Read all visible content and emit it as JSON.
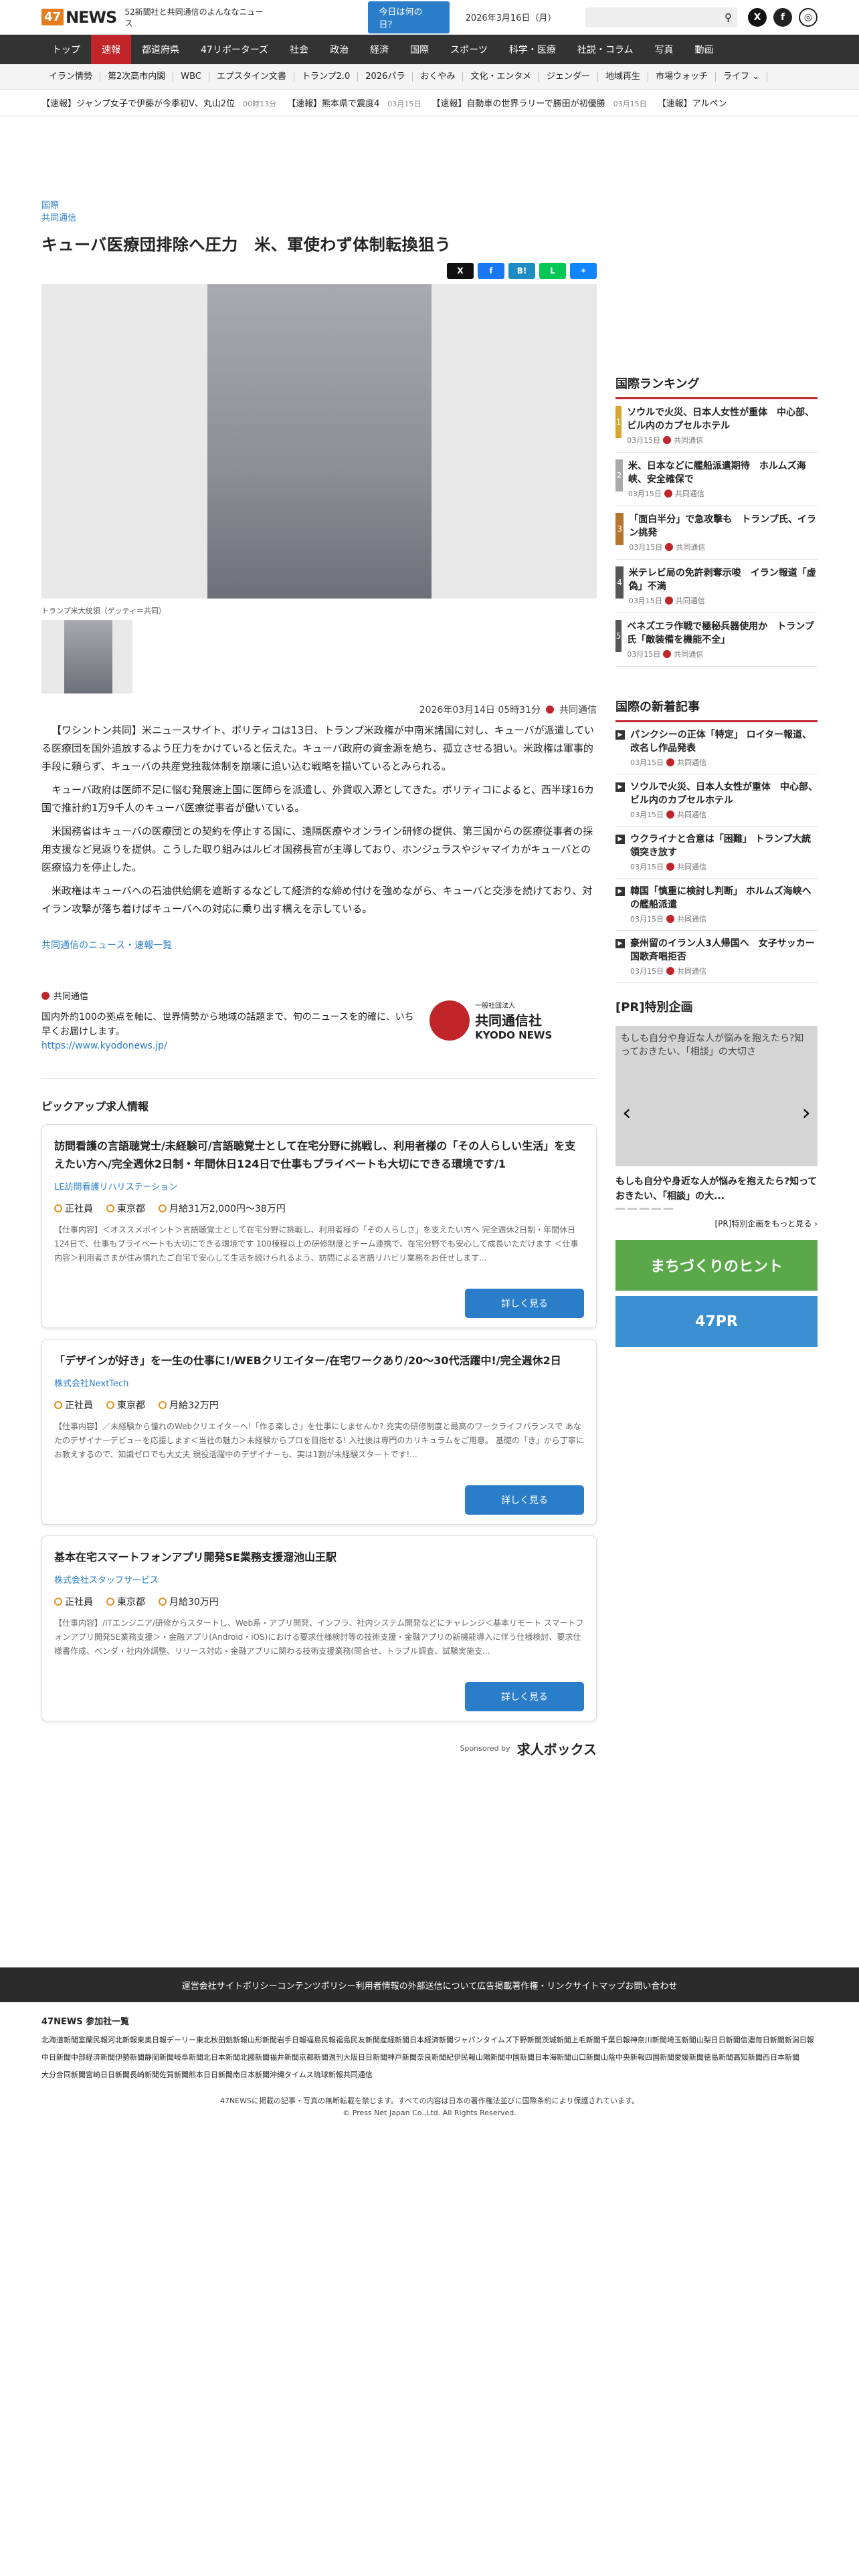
{
  "header": {
    "logo_num": "47",
    "logo_text": "NEWS",
    "tagline": "52新聞社と共同通信のよんななニュース",
    "today_btn": "今日は何の日？",
    "date": "2026年3月16日（月）"
  },
  "nav": [
    "トップ",
    "速報",
    "都道府県",
    "47リポーターズ",
    "社会",
    "政治",
    "経済",
    "国際",
    "スポーツ",
    "科学・医療",
    "社説・コラム",
    "写真",
    "動画"
  ],
  "subnav": [
    "イラン情勢",
    "第2次高市内閣",
    "WBC",
    "エプスタイン文書",
    "トランプ2.0",
    "2026パラ",
    "おくやみ",
    "文化・エンタメ",
    "ジェンダー",
    "地域再生",
    "市場ウォッチ",
    "ライフ ⌄"
  ],
  "ticker": [
    {
      "text": "【速報】ジャンプ女子で伊藤が今季初V、丸山2位",
      "time": "00時13分"
    },
    {
      "text": "【速報】熊本県で震度4",
      "time": "03月15日"
    },
    {
      "text": "【速報】自動車の世界ラリーで勝田が初優勝",
      "time": "03月15日"
    },
    {
      "text": "【速報】アルペン",
      "time": ""
    }
  ],
  "article": {
    "category": "国際",
    "source_link": "共同通信",
    "title": "キューバ医療団排除へ圧力　米、軍使わず体制転換狙う",
    "caption": "トランプ米大統領（ゲッティ＝共同）",
    "datetime": "2026年03月14日 05時31分",
    "source": "共同通信",
    "paragraphs": [
      "【ワシントン共同】米ニュースサイト、ポリティコは13日、トランプ米政権が中南米諸国に対し、キューバが派遣している医療団を国外追放するよう圧力をかけていると伝えた。キューバ政府の資金源を絶ち、孤立させる狙い。米政権は軍事的手段に頼らず、キューバの共産党独裁体制を崩壊に追い込む戦略を描いているとみられる。",
      "キューバ政府は医師不足に悩む発展途上国に医師らを派遣し、外貨収入源としてきた。ポリティコによると、西半球16カ国で推計約1万9千人のキューバ医療従事者が働いている。",
      "米国務省はキューバの医療団との契約を停止する国に、遠隔医療やオンライン研修の提供、第三国からの医療従事者の採用支援など見返りを提供。こうした取り組みはルビオ国務長官が主導しており、ホンジュラスやジャマイカがキューバとの医療協力を停止した。",
      "米政権はキューバへの石油供給網を遮断するなどして経済的な締め付けを強めながら、キューバと交渉を続けており、対イラン攻撃が落ち着けばキューバへの対応に乗り出す構えを示している。"
    ],
    "more": "共同通信のニュース・速報一覧"
  },
  "kyodo": {
    "name": "共同通信",
    "desc": "国内外約100の拠点を軸に、世界情勢から地域の話題まで、旬のニュースを的確に、いち早くお届けします。",
    "url": "https://www.kyodonews.jp/",
    "logo_small": "一般社団法人",
    "logo_jp": "共同通信社",
    "logo_en": "KYODO NEWS"
  },
  "pickup": {
    "title": "ピックアップ求人情報",
    "button": "詳しく見る",
    "jobs": [
      {
        "title": "訪問看護の言語聴覚士/未経験可/言語聴覚士として在宅分野に挑戦し、利用者様の「その人らしい生活」を支えたい方へ/完全週休2日制・年間休日124日で仕事もプライベートも大切にできる環境です/1",
        "company": "LE訪問看護リハリステーション",
        "type": "正社員",
        "place": "東京都",
        "pay": "月給31万2,000円〜38万円",
        "desc": "【仕事内容】＜オススメポイント＞言語聴覚士として在宅分野に挑戦し、利用者様の「その人らしさ」を支えたい方へ 完全週休2日制・年間休日124日で、仕事もプライベートも大切にできる環境です 100棟程以上の研修制度とチーム連携で、在宅分野でも安心して成長いただけます ＜仕事内容＞利用者さまが住み慣れたご自宅で安心して生活を続けられるよう、訪問による言語リハビリ業務をお任せします..."
      },
      {
        "title": "「デザインが好き」を一生の仕事に!/WEBクリエイター/在宅ワークあり/20〜30代活躍中!/完全週休2日",
        "company": "株式会社NextTech",
        "type": "正社員",
        "place": "東京都",
        "pay": "月給32万円",
        "desc": "【仕事内容】／未経験から憧れのWebクリエイターへ!「作る楽しさ」を仕事にしませんか? 充実の研修制度と最高のワークライフバランスで あなたのデザイナーデビューを応援します＜当社の魅力＞未経験からプロを目指せる! 入社後は専門のカリキュラムをご用意。 基礎の「き」から丁寧にお教えするので、知識ゼロでも大丈夫 現役活躍中のデザイナーも、実は1割が未経験スタートです!..."
      },
      {
        "title": "基本在宅スマートフォンアプリ開発SE業務支援溜池山王駅",
        "company": "株式会社スタッフサービス",
        "type": "正社員",
        "place": "東京都",
        "pay": "月給30万円",
        "desc": "【仕事内容】/ITエンジニア/研修からスタートし、Web系・アプリ開発、インフラ、社内システム開発などにチャレンジ＜基本リモート スマートフォンアプリ開発SE業務支援＞・金融アプリ(Android・iOS)における要求仕様検討等の技術支援・金融アプリの新機能導入に伴う仕様検討、要求仕様書作成、ベンダ・社内外調整、リリース対応・金融アプリに関わる技術支援業務(問合せ、トラブル調査、試験実施支..."
      }
    ],
    "sponsor": "Sponsored by",
    "sponsor_name": "求人ボックス"
  },
  "ranking": {
    "title": "国際ランキング",
    "items": [
      {
        "title": "ソウルで火災、日本人女性が重体　中心部、ビル内のカプセルホテル",
        "date": "03月15日",
        "src": "共同通信"
      },
      {
        "title": "米、日本などに艦船派遣期待　ホルムズ海峡、安全確保で",
        "date": "03月15日",
        "src": "共同通信"
      },
      {
        "title": "「面白半分」で急攻撃も　トランプ氏、イラン挑発",
        "date": "03月15日",
        "src": "共同通信"
      },
      {
        "title": "米テレビ局の免許剥奪示唆　イラン報道「虚偽」不満",
        "date": "03月15日",
        "src": "共同通信"
      },
      {
        "title": "ベネズエラ作戦で極秘兵器使用か　トランプ氏「敵装備を機能不全」",
        "date": "03月15日",
        "src": "共同通信"
      }
    ]
  },
  "newest": {
    "title": "国際の新着記事",
    "items": [
      {
        "title": "パンクシーの正体「特定」 ロイター報道、改名し作品発表",
        "date": "03月15日",
        "src": "共同通信"
      },
      {
        "title": "ソウルで火災、日本人女性が重体　中心部、ビル内のカプセルホテル",
        "date": "03月15日",
        "src": "共同通信"
      },
      {
        "title": "ウクライナと合意は「困難」 トランプ大統領突き放す",
        "date": "03月15日",
        "src": "共同通信"
      },
      {
        "title": "韓国「慎重に検討し判断」 ホルムズ海峡への艦船派遣",
        "date": "03月15日",
        "src": "共同通信"
      },
      {
        "title": "豪州留のイラン人3人帰国へ　女子サッカー国歌斉唱拒否",
        "date": "03月15日",
        "src": "共同通信"
      }
    ]
  },
  "pr": {
    "title": "[PR]特別企画",
    "alt": "もしも自分や身近な人が悩みを抱えたら?知っておきたい、「相談」の大切さ",
    "caption": "もしも自分や身近な人が悩みを抱えたら?知っておきたい、「相談」の大...",
    "more": "[PR]特別企画をもっと見る ›",
    "banner1": "まちづくりのヒント",
    "banner2": "47PR"
  },
  "footer": {
    "links": [
      "運営会社",
      "サイトポリシー",
      "コンテンツポリシー",
      "利用者情報の外部送信について",
      "広告掲載",
      "著作権・リンク",
      "サイトマップ",
      "お問い合わせ"
    ],
    "papers_title": "47NEWS 参加社一覧",
    "papers": [
      "北海道新聞",
      "室蘭民報",
      "河北新報",
      "東奥日報",
      "デーリー東北",
      "秋田魁新報",
      "山形新聞",
      "岩手日報",
      "福島民報",
      "福島民友新聞",
      "産経新聞",
      "日本経済新聞",
      "ジャパンタイムズ",
      "下野新聞",
      "茨城新聞",
      "上毛新聞",
      "千葉日報",
      "神奈川新聞",
      "埼玉新聞",
      "山梨日日新聞",
      "信濃毎日新聞",
      "新潟日報",
      "中日新聞",
      "中部経済新聞",
      "伊勢新聞",
      "静岡新聞",
      "岐阜新聞",
      "北日本新聞",
      "北國新聞",
      "福井新聞",
      "京都新聞",
      "週刊大阪日日新聞",
      "神戸新聞",
      "奈良新聞",
      "紀伊民報",
      "山陽新聞",
      "中国新聞",
      "日本海新聞",
      "山口新聞",
      "山陰中央新報",
      "四国新聞",
      "愛媛新聞",
      "徳島新聞",
      "高知新聞",
      "西日本新聞",
      "大分合同新聞",
      "宮崎日日新聞",
      "長崎新聞",
      "佐賀新聞",
      "熊本日日新聞",
      "南日本新聞",
      "沖縄タイムス",
      "琉球新報",
      "共同通信"
    ],
    "copy1": "47NEWSに掲載の記事・写真の無断転載を禁じます。すべての内容は日本の著作権法並びに国際条約により保護されています。",
    "copy2": "© Press Net Japan Co.,Ltd. All Rights Reserved."
  }
}
